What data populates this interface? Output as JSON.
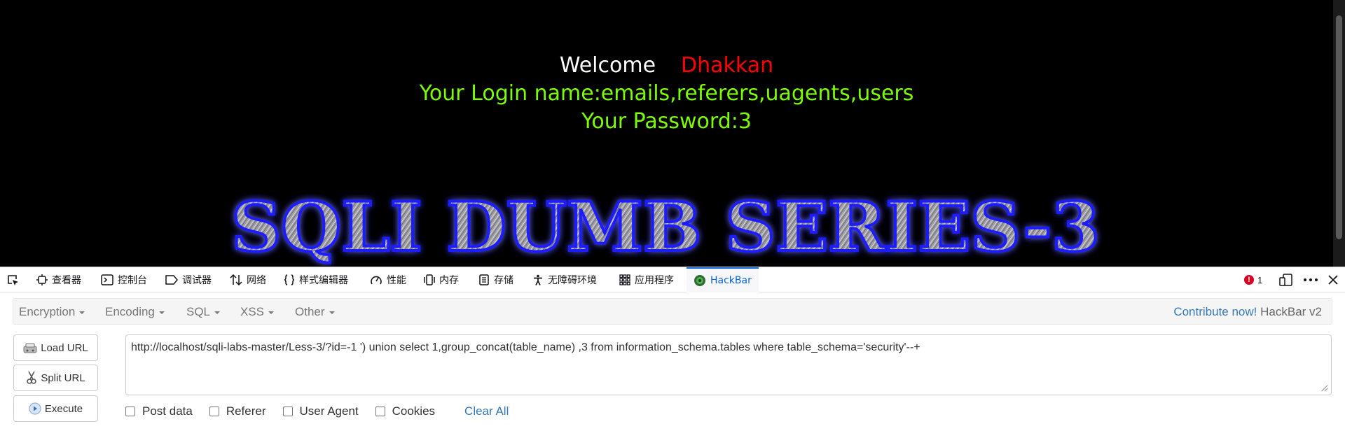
{
  "page": {
    "welcome_label": "Welcome",
    "username": "Dhakkan",
    "login_line": "Your Login name:emails,referers,uagents,users",
    "password_line": "Your Password:3",
    "banner_text": "SQLI DUMB SERIES-3"
  },
  "devtools": {
    "tabs": [
      {
        "label": "查看器",
        "icon": "inspector-icon"
      },
      {
        "label": "控制台",
        "icon": "console-icon"
      },
      {
        "label": "调试器",
        "icon": "debugger-icon"
      },
      {
        "label": "网络",
        "icon": "network-icon"
      },
      {
        "label": "样式编辑器",
        "icon": "style-editor-icon"
      },
      {
        "label": "性能",
        "icon": "performance-icon"
      },
      {
        "label": "内存",
        "icon": "memory-icon"
      },
      {
        "label": "存储",
        "icon": "storage-icon"
      },
      {
        "label": "无障碍环境",
        "icon": "accessibility-icon"
      },
      {
        "label": "应用程序",
        "icon": "application-icon"
      },
      {
        "label": "HackBar",
        "icon": "hackbar-icon"
      }
    ],
    "error_count": "1"
  },
  "hackbar": {
    "menu": [
      "Encryption",
      "Encoding",
      "SQL",
      "XSS",
      "Other"
    ],
    "contribute_link": "Contribute now!",
    "version": "HackBar v2",
    "buttons": {
      "load_url": "Load URL",
      "split_url": "Split URL",
      "execute": "Execute"
    },
    "url_value": "http://localhost/sqli-labs-master/Less-3/?id=-1 ') union select 1,group_concat(table_name) ,3 from information_schema.tables where table_schema='security'--+",
    "options": [
      "Post data",
      "Referer",
      "User Agent",
      "Cookies"
    ],
    "clear_all": "Clear All"
  },
  "colors": {
    "page_bg": "#000000",
    "username": "#ff0000",
    "login_text": "#7cfc00",
    "banner_glow": "#1a1aff",
    "active_tab": "#0a64d6",
    "link": "#337ab7"
  }
}
